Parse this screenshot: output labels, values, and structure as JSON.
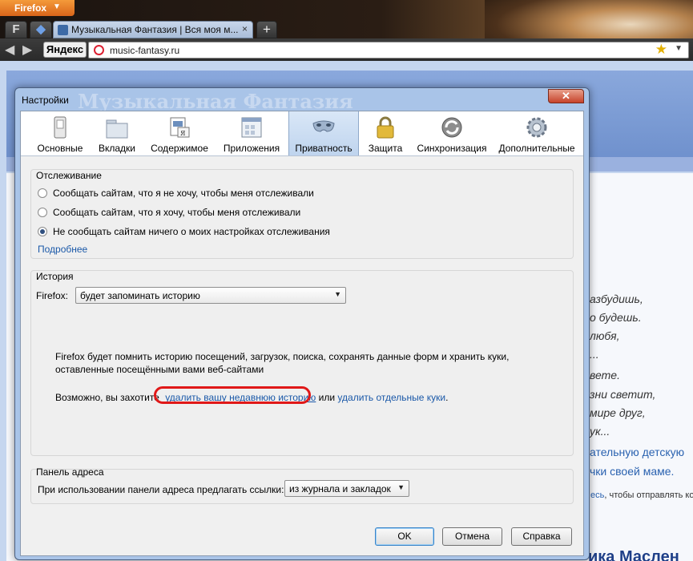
{
  "browser": {
    "menu_label": "Firefox",
    "tab_title": "Музыкальная Фантазия | Вся моя м...",
    "tab_close": "×",
    "new_tab": "+",
    "search_engine": "Яндекс",
    "url": "music-fantasy.ru"
  },
  "page": {
    "dialog_ghost_text": "Музыкальная Фантазия",
    "poem_lines": [
      "азбудишь,",
      "о будешь.",
      "любя,",
      "...",
      "вете.",
      "зни светит,",
      "мире друг,",
      "ук..."
    ],
    "link_lines": [
      "ательную детскую",
      "чки своей маме."
    ],
    "footer_link": "есь",
    "footer_rest": ", чтобы отправлять ко",
    "big_title": "ика Маслен"
  },
  "dialog": {
    "title": "Настройки",
    "close_label": "✕",
    "categories": [
      {
        "label": "Основные",
        "icon": "general-switch-icon"
      },
      {
        "label": "Вкладки",
        "icon": "tabs-folder-icon"
      },
      {
        "label": "Содержимое",
        "icon": "content-page-icon"
      },
      {
        "label": "Приложения",
        "icon": "applications-icon"
      },
      {
        "label": "Приватность",
        "icon": "privacy-mask-icon"
      },
      {
        "label": "Защита",
        "icon": "security-lock-icon"
      },
      {
        "label": "Синхронизация",
        "icon": "sync-icon"
      },
      {
        "label": "Дополнительные",
        "icon": "advanced-gear-icon"
      }
    ],
    "active_category": "Приватность",
    "tracking": {
      "title": "Отслеживание",
      "options": [
        "Сообщать сайтам, что я не хочу, чтобы меня отслеживали",
        "Сообщать сайтам, что я хочу, чтобы меня отслеживали",
        "Не сообщать сайтам ничего о моих настройках отслеживания"
      ],
      "selected_index": 2,
      "more_link": "Подробнее"
    },
    "history": {
      "title": "История",
      "firefox_label": "Firefox:",
      "mode_value": "будет запоминать историю",
      "description_line1": "Firefox будет помнить историю посещений, загрузок, поиска, сохранять данные форм и хранить куки,",
      "description_line2": "оставленные посещёнными вами веб-сайтами",
      "suggest_prefix": "Возможно, вы захотите",
      "clear_recent_link": "удалить вашу недавнюю историю",
      "suggest_or": "или",
      "remove_cookies_link": "удалить отдельные куки",
      "suggest_end": "."
    },
    "address_bar": {
      "title": "Панель адреса",
      "label": "При использовании панели адреса предлагать ссылки:",
      "value": "из журнала и закладок"
    },
    "buttons": {
      "ok": "OK",
      "cancel": "Отмена",
      "help": "Справка"
    },
    "accent_colors": {
      "highlight_ring": "#e01818",
      "link": "#1a58a8"
    }
  }
}
